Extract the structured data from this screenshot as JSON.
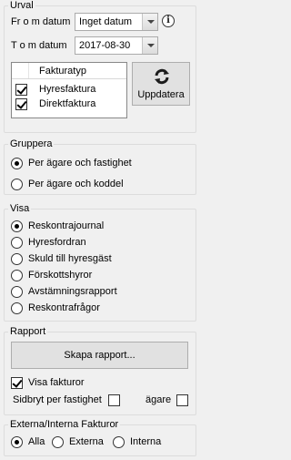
{
  "urval": {
    "title": "Urval",
    "from_label": "Fr o m datum",
    "from_value": "Inget datum",
    "tom_label": "T o m datum",
    "tom_value": "2017-08-30",
    "info_icon": "info-icon",
    "table_header": "Fakturatyp",
    "rows": [
      {
        "label": "Hyresfaktura",
        "checked": true
      },
      {
        "label": "Direktfaktura",
        "checked": true
      }
    ],
    "refresh_label": "Uppdatera",
    "refresh_icon": "refresh-icon",
    "refresh_color": "#1c1c1c"
  },
  "gruppera": {
    "title": "Gruppera",
    "options": [
      {
        "label": "Per ägare och fastighet",
        "selected": true
      },
      {
        "label": "Per ägare och koddel",
        "selected": false
      }
    ]
  },
  "visa": {
    "title": "Visa",
    "options": [
      {
        "label": "Reskontrajournal",
        "selected": true
      },
      {
        "label": "Hyresfordran",
        "selected": false
      },
      {
        "label": "Skuld till hyresgäst",
        "selected": false
      },
      {
        "label": "Förskottshyror",
        "selected": false
      },
      {
        "label": "Avstämningsrapport",
        "selected": false
      },
      {
        "label": "Reskontrafrågor",
        "selected": false
      }
    ]
  },
  "rapport": {
    "title": "Rapport",
    "create_label": "Skapa rapport...",
    "show_invoices_label": "Visa fakturor",
    "show_invoices_checked": true,
    "page_break_property_label": "Sidbryt per fastighet",
    "page_break_property_checked": false,
    "owner_label": "ägare",
    "owner_checked": false
  },
  "externa": {
    "title": "Externa/Interna Fakturor",
    "options": [
      {
        "label": "Alla",
        "selected": true
      },
      {
        "label": "Externa",
        "selected": false
      },
      {
        "label": "Interna",
        "selected": false
      }
    ]
  }
}
